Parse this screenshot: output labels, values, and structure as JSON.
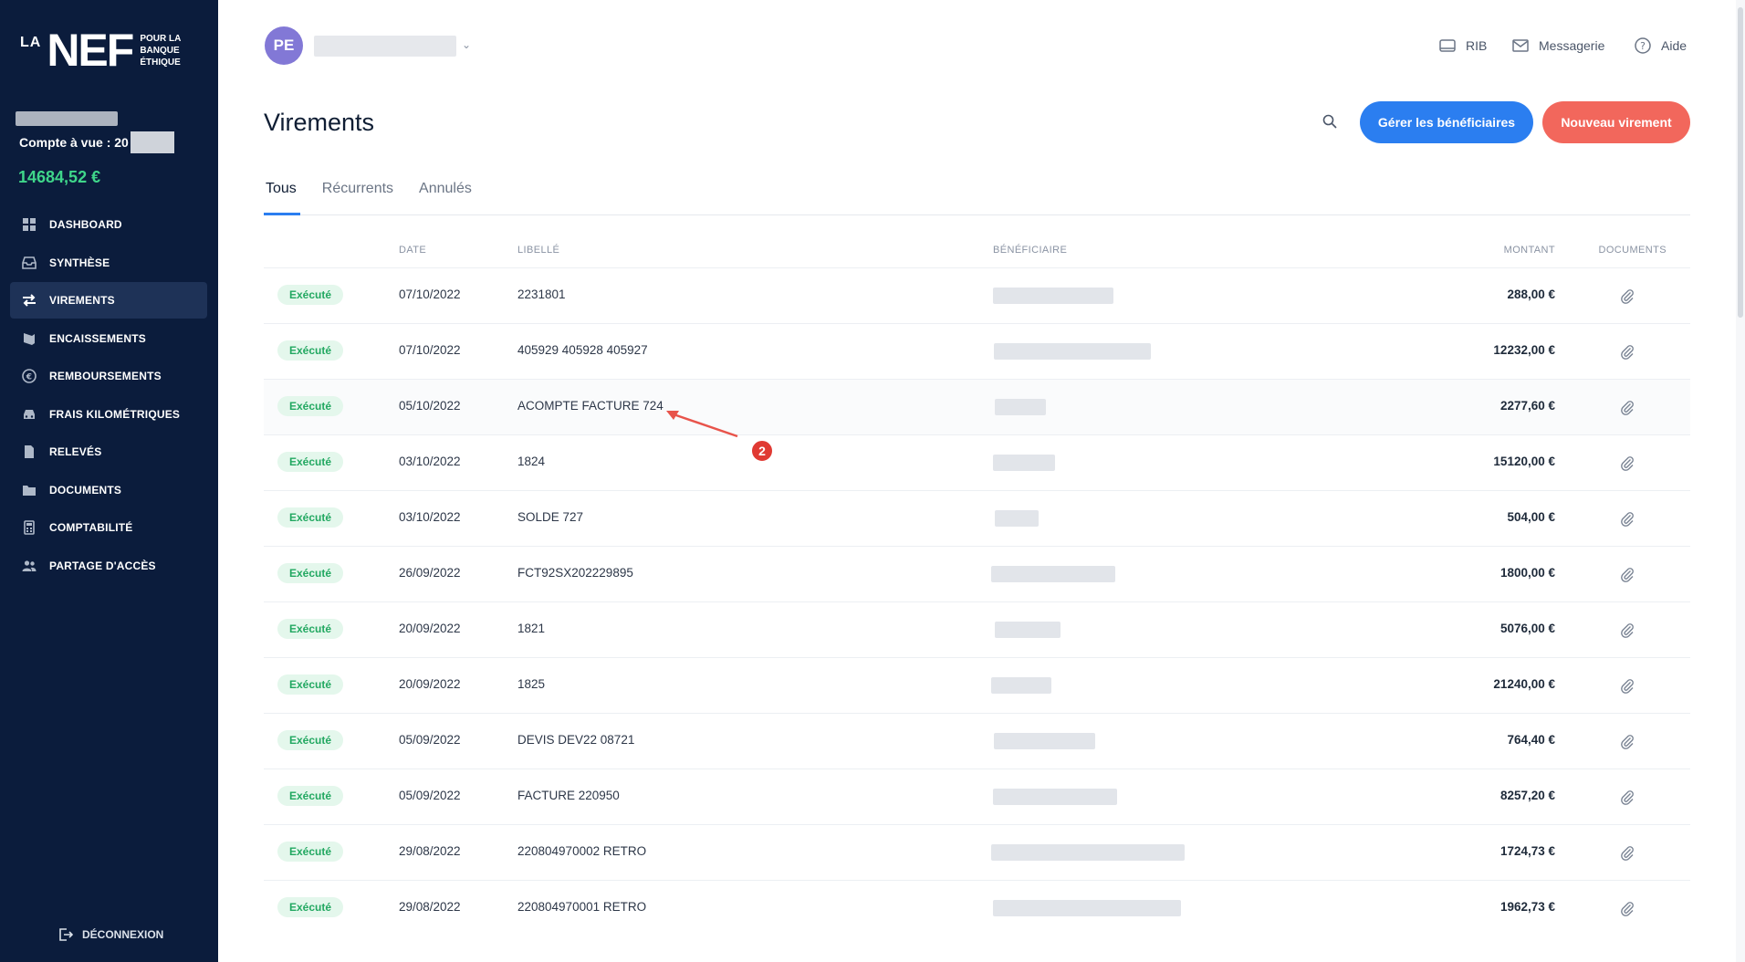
{
  "sidebar": {
    "logo": {
      "la": "LA",
      "nef": "NEF",
      "tagline": [
        "POUR LA",
        "BANQUE",
        "ÉTHIQUE"
      ]
    },
    "account_label": "Compte à vue : 20",
    "balance": "14684,52 €",
    "items": [
      {
        "label": "DASHBOARD",
        "icon": "grid-icon",
        "active": false
      },
      {
        "label": "SYNTHÈSE",
        "icon": "inbox-icon",
        "active": false
      },
      {
        "label": "VIREMENTS",
        "icon": "transfer-arrows-icon",
        "active": true
      },
      {
        "label": "ENCAISSEMENTS",
        "icon": "collect-icon",
        "active": false
      },
      {
        "label": "REMBOURSEMENTS",
        "icon": "euro-refund-icon",
        "active": false
      },
      {
        "label": "FRAIS KILOMÉTRIQUES",
        "icon": "car-icon",
        "active": false
      },
      {
        "label": "RELEVÉS",
        "icon": "file-icon",
        "active": false
      },
      {
        "label": "DOCUMENTS",
        "icon": "folder-icon",
        "active": false
      },
      {
        "label": "COMPTABILITÉ",
        "icon": "calculator-icon",
        "active": false
      },
      {
        "label": "PARTAGE D'ACCÈS",
        "icon": "users-icon",
        "active": false
      }
    ],
    "logout_label": "DÉCONNEXION"
  },
  "header": {
    "avatar_initials": "PE",
    "links": {
      "rib": "RIB",
      "messagerie": "Messagerie",
      "aide": "Aide"
    }
  },
  "page": {
    "title": "Virements",
    "manage_button": "Gérer les bénéficiaires",
    "new_button": "Nouveau virement",
    "tabs": [
      "Tous",
      "Récurrents",
      "Annulés"
    ],
    "active_tab": "Tous"
  },
  "table": {
    "headers": {
      "date": "DATE",
      "label": "LIBELLÉ",
      "beneficiary": "BÉNÉFICIAIRE",
      "amount": "MONTANT",
      "documents": "DOCUMENTS"
    },
    "rows": [
      {
        "status": "Exécuté",
        "date": "07/10/2022",
        "label": "2231801",
        "amount": "288,00 €"
      },
      {
        "status": "Exécuté",
        "date": "07/10/2022",
        "label": "405929 405928 405927",
        "amount": "12232,00 €"
      },
      {
        "status": "Exécuté",
        "date": "05/10/2022",
        "label": "ACOMPTE FACTURE 724",
        "amount": "2277,60 €"
      },
      {
        "status": "Exécuté",
        "date": "03/10/2022",
        "label": "1824",
        "amount": "15120,00 €"
      },
      {
        "status": "Exécuté",
        "date": "03/10/2022",
        "label": "SOLDE 727",
        "amount": "504,00 €"
      },
      {
        "status": "Exécuté",
        "date": "26/09/2022",
        "label": "FCT92SX202229895",
        "amount": "1800,00 €"
      },
      {
        "status": "Exécuté",
        "date": "20/09/2022",
        "label": "1821",
        "amount": "5076,00 €"
      },
      {
        "status": "Exécuté",
        "date": "20/09/2022",
        "label": "1825",
        "amount": "21240,00 €"
      },
      {
        "status": "Exécuté",
        "date": "05/09/2022",
        "label": "DEVIS DEV22 08721",
        "amount": "764,40 €"
      },
      {
        "status": "Exécuté",
        "date": "05/09/2022",
        "label": "FACTURE 220950",
        "amount": "8257,20 €"
      },
      {
        "status": "Exécuté",
        "date": "29/08/2022",
        "label": "220804970002 RETRO",
        "amount": "1724,73 €"
      },
      {
        "status": "Exécuté",
        "date": "29/08/2022",
        "label": "220804970001 RETRO",
        "amount": "1962,73 €"
      }
    ]
  },
  "annotation": {
    "number": "2"
  },
  "colors": {
    "sidebar": "#0b1c3c",
    "accent_blue": "#2b7ef0",
    "accent_red": "#f2675c",
    "balance_green": "#3fd68a",
    "status_green": "#22a861"
  }
}
